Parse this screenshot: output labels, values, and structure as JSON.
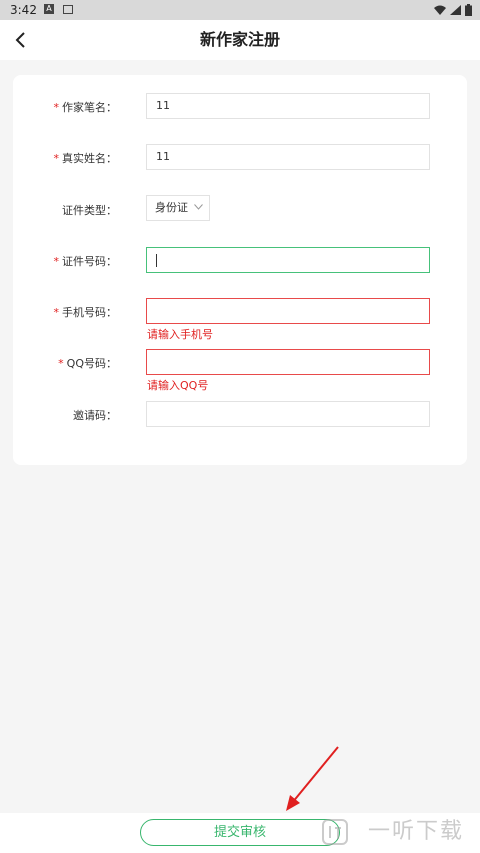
{
  "status": {
    "time": "3:42",
    "a_badge": "A"
  },
  "nav": {
    "title": "新作家注册"
  },
  "form": {
    "pen_name": {
      "label": "作家笔名：",
      "value": "11",
      "required": true
    },
    "real_name": {
      "label": "真实姓名：",
      "value": "11",
      "required": true
    },
    "id_type": {
      "label": "证件类型：",
      "value": "身份证",
      "required": false
    },
    "id_number": {
      "label": "证件号码：",
      "value": "",
      "required": true
    },
    "phone": {
      "label": "手机号码：",
      "value": "",
      "required": true,
      "error": "请输入手机号"
    },
    "qq": {
      "label": "QQ号码：",
      "value": "",
      "required": true,
      "error": "请输入QQ号"
    },
    "invite": {
      "label": "邀请码：",
      "value": "",
      "required": false
    }
  },
  "required_mark": "*",
  "submit": {
    "label": "提交审核"
  },
  "watermark": {
    "text": "一听下载"
  },
  "colors": {
    "accent": "#38b66d",
    "error": "#e02020",
    "focus": "#46c17a"
  }
}
